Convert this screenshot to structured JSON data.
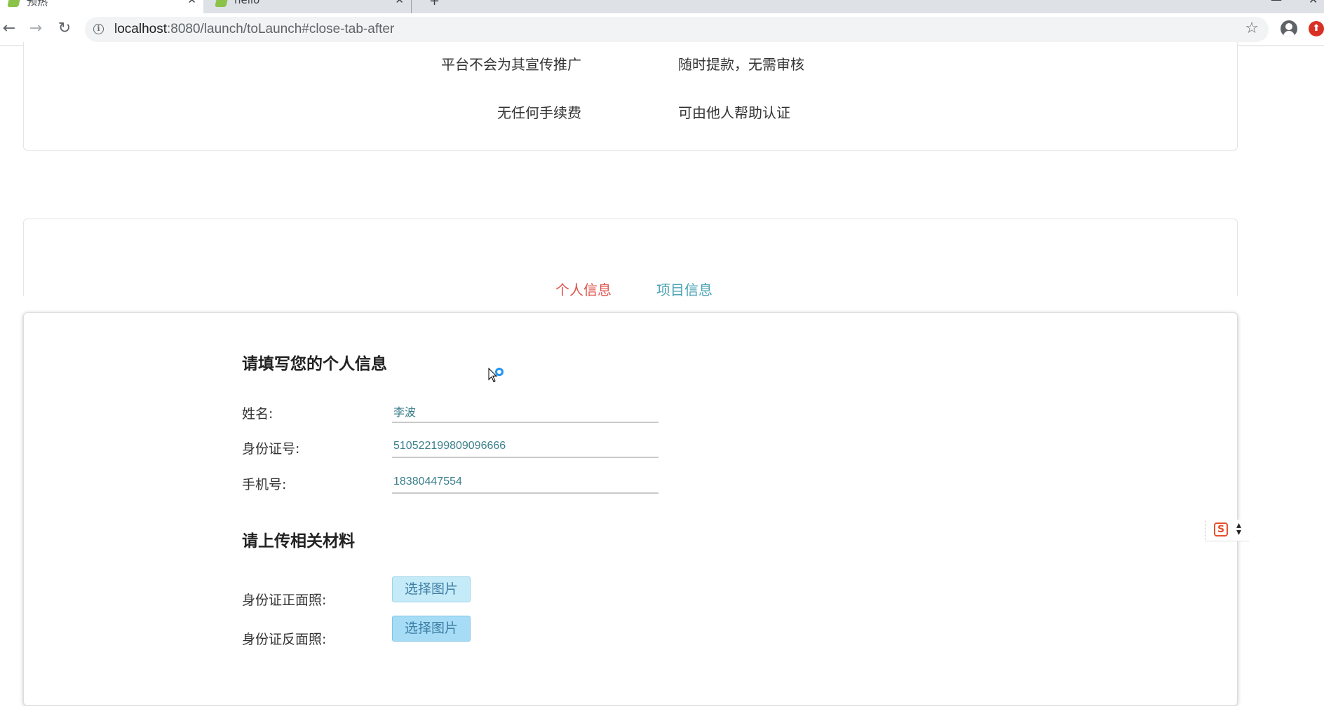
{
  "browser": {
    "tabs": [
      {
        "title": "预热"
      },
      {
        "title": "hello"
      }
    ],
    "url_host": "localhost",
    "url_rest": ":8080/launch/toLaunch#close-tab-after"
  },
  "features": {
    "row1_left": "平台不会为其宣传推广",
    "row1_right": "随时提款，无需审核",
    "row2_left": "无任何手续费",
    "row2_right": "可由他人帮助认证"
  },
  "tabs": {
    "personal": "个人信息",
    "project": "项目信息",
    "active": "个人信息"
  },
  "form": {
    "personal_title": "请填写您的个人信息",
    "name_label": "姓名:",
    "name_value": "李波",
    "id_label": "身份证号:",
    "id_value": "510522199809096666",
    "phone_label": "手机号:",
    "phone_value": "18380447554",
    "upload_title": "请上传相关材料",
    "id_front_label": "身份证正面照:",
    "id_back_label": "身份证反面照:",
    "choose_image_label": "选择图片"
  },
  "colors": {
    "active_tab": "#e0554d",
    "inactive_tab": "#4aa3b5",
    "input_text": "#3b7f8c",
    "upload_button": "#c5ebf8"
  },
  "icons": [
    "back-arrow-icon",
    "forward-arrow-icon",
    "reload-icon",
    "info-icon",
    "star-icon",
    "account-icon",
    "extension-icon",
    "cursor-icon",
    "s-logo-icon",
    "more-icon"
  ]
}
